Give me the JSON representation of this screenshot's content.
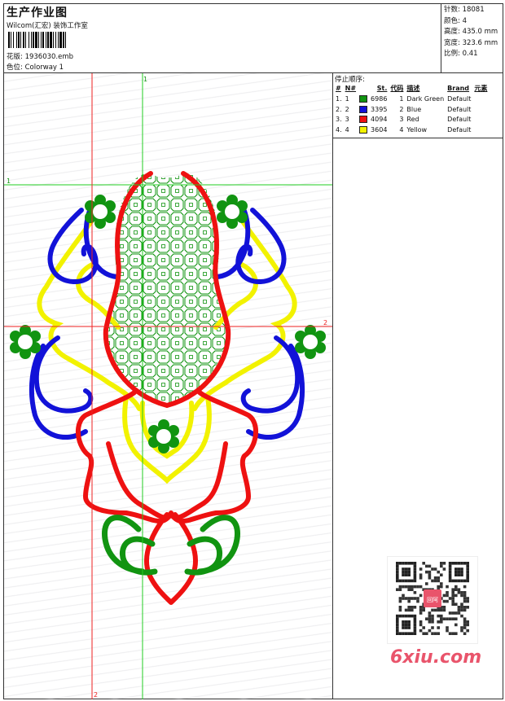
{
  "header": {
    "title": "生产作业图",
    "subtitle": "Wilcom(汇宏) 装饰工作室",
    "design_label": "花版:",
    "design_value": "1936030.emb",
    "colorway_label": "色位:",
    "colorway_value": "Colorway 1"
  },
  "stats": {
    "stitches_label": "针数:",
    "stitches_value": "18081",
    "colors_label": "颜色:",
    "colors_value": "4",
    "height_label": "高度:",
    "height_value": "435.0 mm",
    "width_label": "宽度:",
    "width_value": "323.6 mm",
    "scale_label": "比例:",
    "scale_value": "0.41"
  },
  "stop_sequence": {
    "title": "停止顺序:",
    "headers": [
      "#",
      "N#",
      "St.",
      "代码",
      "描述",
      "Brand",
      "元素"
    ],
    "rows": [
      {
        "index": "1.",
        "needle": "1",
        "color": "#119411",
        "stitches": "6986",
        "code": "1",
        "description": "Dark Green",
        "brand": "Default"
      },
      {
        "index": "2.",
        "needle": "2",
        "color": "#1212d8",
        "stitches": "3395",
        "code": "2",
        "description": "Blue",
        "brand": "Default"
      },
      {
        "index": "3.",
        "needle": "3",
        "color": "#ee1111",
        "stitches": "4094",
        "code": "3",
        "description": "Red",
        "brand": "Default"
      },
      {
        "index": "4.",
        "needle": "4",
        "color": "#f2f200",
        "stitches": "3604",
        "code": "4",
        "description": "Yellow",
        "brand": "Default"
      }
    ]
  },
  "guides": {
    "green_vertical_label": "1",
    "green_horizontal_label": "1",
    "red_horizontal_label": "2",
    "red_vertical_label": "2"
  },
  "watermark": {
    "text": "6xiu.com",
    "qr_badge": "回阿"
  },
  "colors": {
    "green": "#119411",
    "blue": "#1212d8",
    "red": "#ee1111",
    "yellow": "#f2f200",
    "guide_green": "#22cc22",
    "guide_red": "#ee2222"
  }
}
